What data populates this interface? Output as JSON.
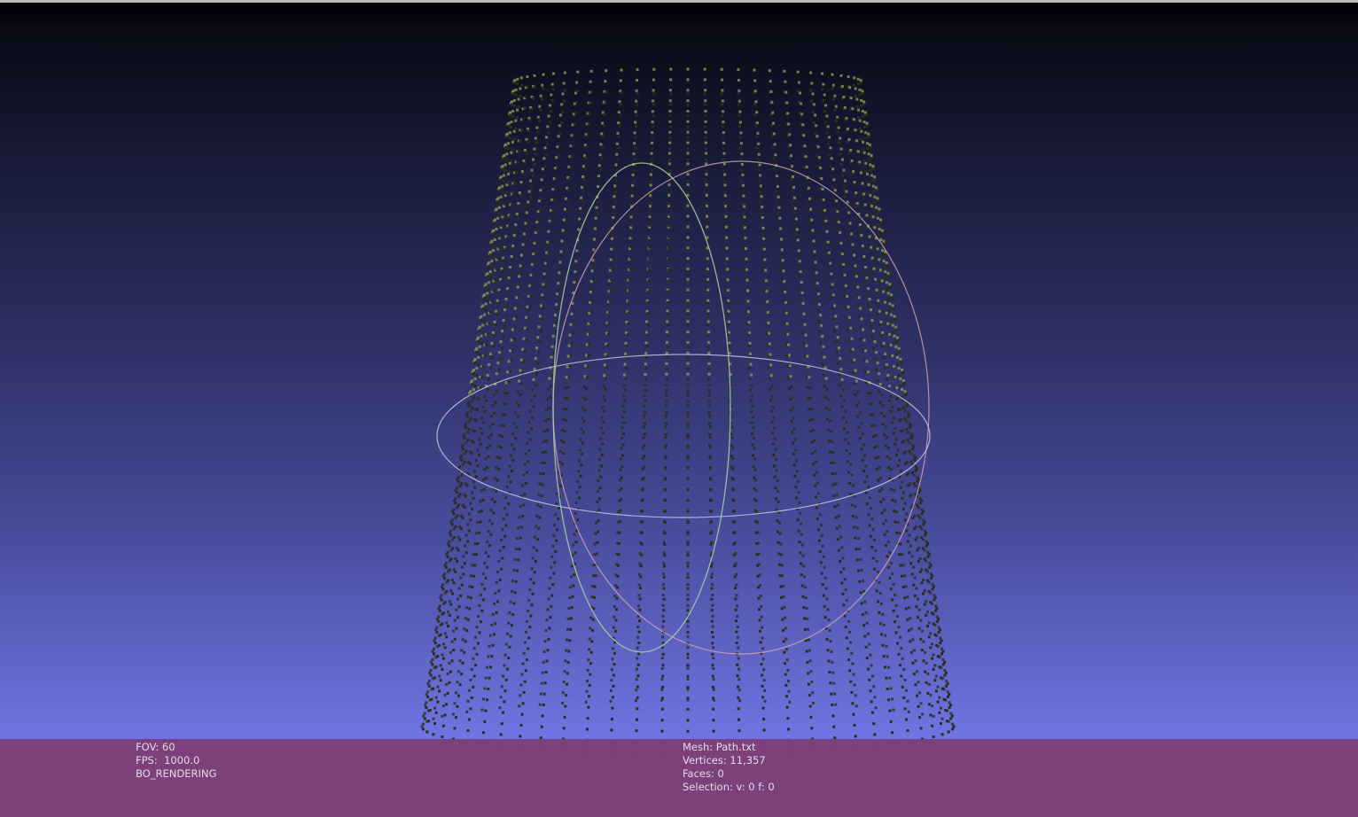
{
  "viewer": {
    "background_top": "#000000",
    "background_bottom": "#6f74e2",
    "info_bar_color": "#7d3e78",
    "point_color_dark": "#2b2d1e",
    "point_color_light": "#8c9a55",
    "trackball_colors": [
      "#a9d3a0",
      "#d7aab0",
      "#d8d8e8"
    ]
  },
  "info_left": {
    "fov": "FOV: 60",
    "fps": "FPS:  1000.0",
    "mode": "BO_RENDERING"
  },
  "info_right": {
    "mesh": "Mesh: Path.txt",
    "vertices": "Vertices: 11,357",
    "faces": "Faces: 0",
    "selection": "Selection: v: 0 f: 0"
  }
}
